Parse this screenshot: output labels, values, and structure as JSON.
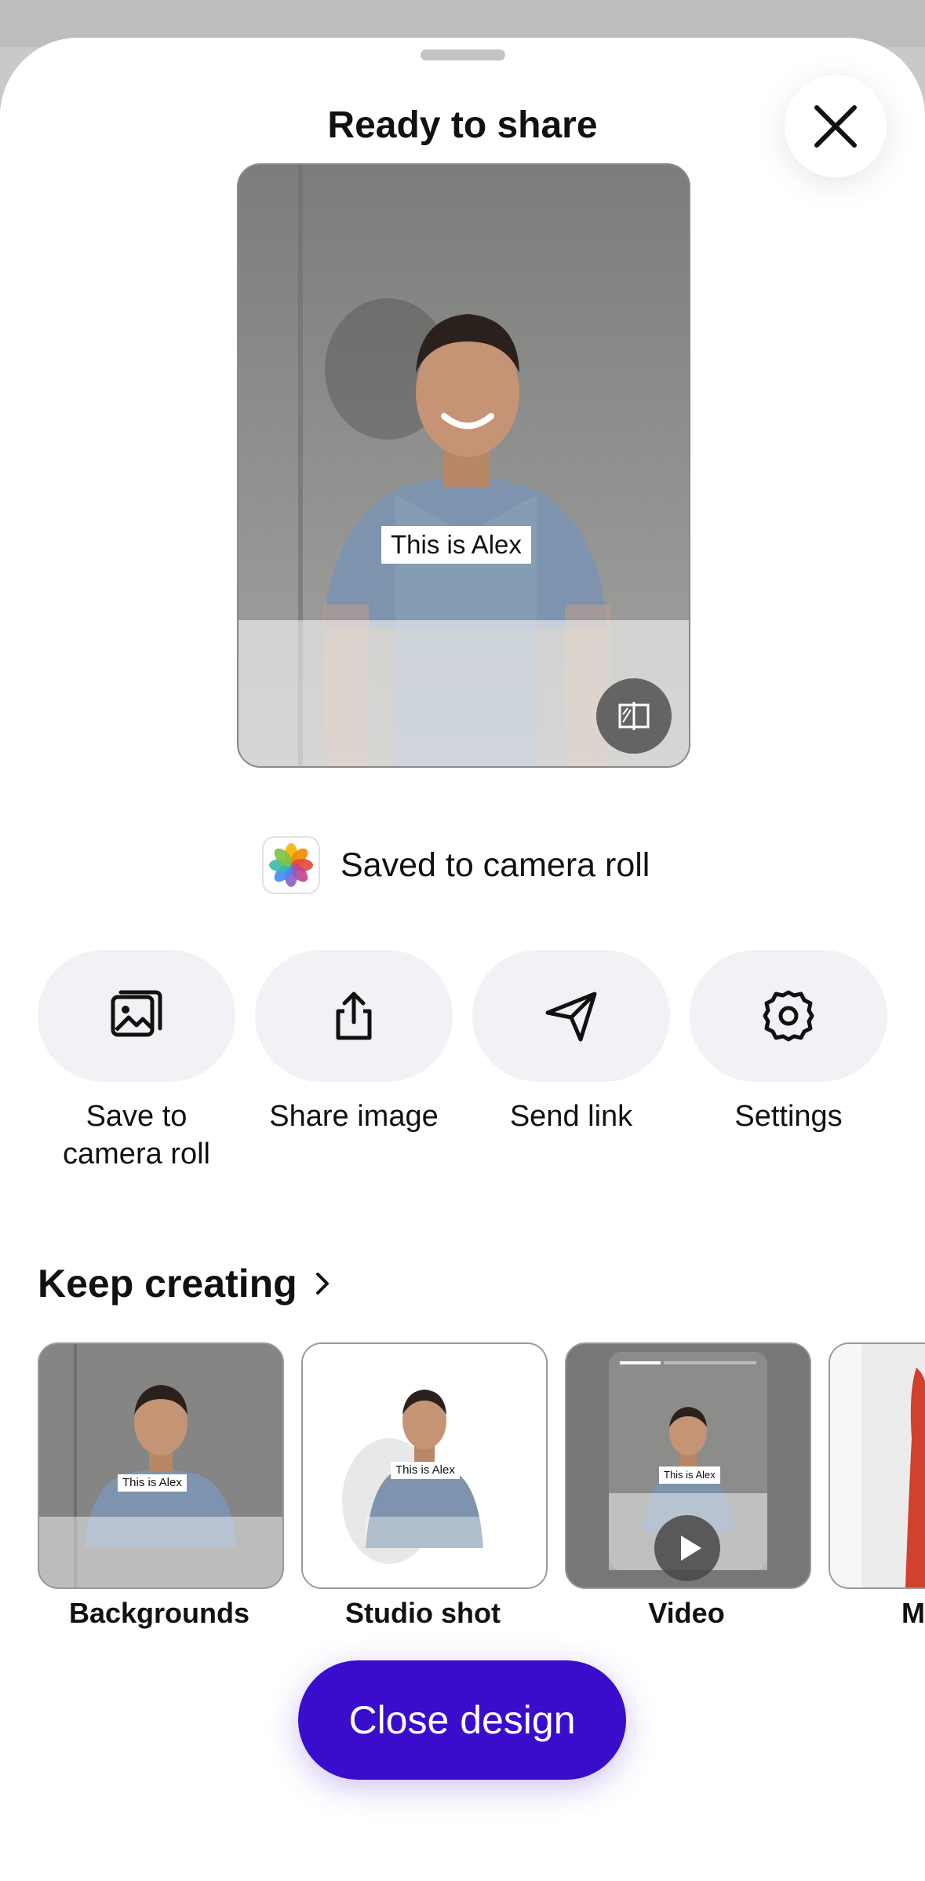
{
  "header": {
    "title": "Ready to share",
    "close_icon": "close-icon"
  },
  "preview": {
    "caption_tag": "This is Alex",
    "compare_icon": "compare-icon"
  },
  "saved_status": {
    "icon": "photos-app-icon",
    "text": "Saved to camera roll"
  },
  "actions": [
    {
      "label": "Save to camera roll",
      "icon": "gallery-icon"
    },
    {
      "label": "Share image",
      "icon": "share-icon"
    },
    {
      "label": "Send link",
      "icon": "send-icon"
    },
    {
      "label": "Settings",
      "icon": "gear-icon"
    }
  ],
  "keep_creating": {
    "heading": "Keep creating",
    "cards": [
      {
        "label": "Backgrounds",
        "tag": "This is Alex"
      },
      {
        "label": "Studio shot",
        "tag": "This is Alex"
      },
      {
        "label": "Video",
        "tag": "This is Alex"
      },
      {
        "label": "M"
      }
    ]
  },
  "footer": {
    "close_design_label": "Close design"
  },
  "colors": {
    "primary": "#3a0ccc",
    "action_bg": "#f1f2f5"
  }
}
